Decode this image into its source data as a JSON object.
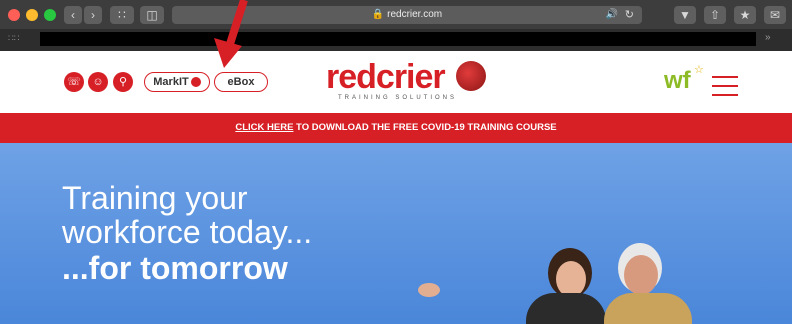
{
  "browser": {
    "url": "redcrier.com"
  },
  "header": {
    "pills": [
      "MarkIT",
      "eBox"
    ],
    "logo": {
      "wordmark": "redcrier",
      "tagline": "TRAINING SOLUTIONS"
    },
    "wf_logo": "wf"
  },
  "banner": {
    "link_text": "CLICK HERE",
    "rest_text": " TO DOWNLOAD THE FREE COVID-19 TRAINING COURSE"
  },
  "hero": {
    "line1": "Training your",
    "line2": "workforce today...",
    "line3": "...for tomorrow"
  },
  "colors": {
    "brand_red": "#d71f26",
    "sky_blue": "#5a93e0",
    "wf_green": "#8dbb25"
  }
}
